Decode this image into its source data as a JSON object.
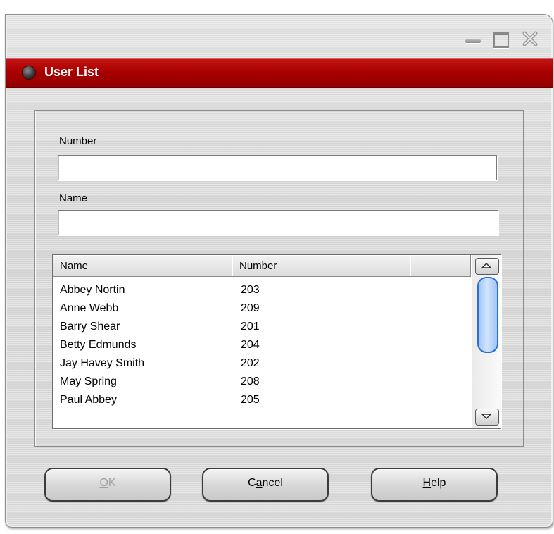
{
  "window": {
    "title": "User List"
  },
  "form": {
    "number_label": "Number",
    "number_value": "",
    "name_label": "Name",
    "name_value": ""
  },
  "list": {
    "columns": [
      "Name",
      "Number",
      ""
    ],
    "rows": [
      {
        "name": "Abbey Nortin",
        "number": "203"
      },
      {
        "name": "Anne Webb",
        "number": "209"
      },
      {
        "name": "Barry Shear",
        "number": "201"
      },
      {
        "name": "Betty Edmunds",
        "number": "204"
      },
      {
        "name": "Jay Havey Smith",
        "number": "202"
      },
      {
        "name": "May Spring",
        "number": "208"
      },
      {
        "name": "Paul Abbey",
        "number": "205"
      }
    ]
  },
  "buttons": {
    "ok": {
      "pre": "",
      "accel": "O",
      "post": "K"
    },
    "cancel": {
      "pre": "C",
      "accel": "a",
      "post": "ncel"
    },
    "help": {
      "pre": "",
      "accel": "H",
      "post": "elp"
    }
  },
  "colors": {
    "titlebar": "#a90000",
    "scroll_thumb": "#9ec4f6"
  },
  "icons": {
    "minimize": "minimize-icon",
    "maximize": "maximize-icon",
    "close": "close-icon",
    "title": "window-status-dot-icon",
    "scroll_up": "chevron-up-icon",
    "scroll_down": "chevron-down-icon"
  }
}
